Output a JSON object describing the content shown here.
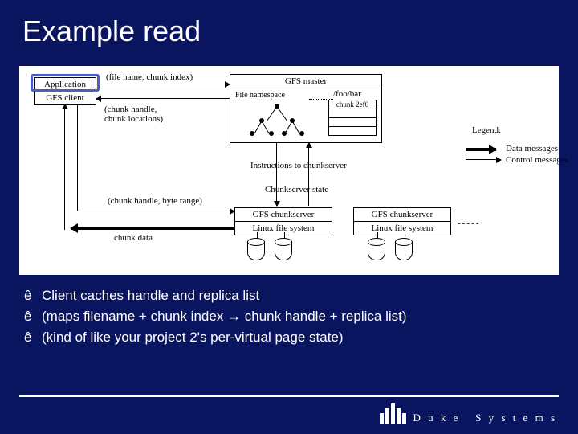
{
  "title": "Example read",
  "diagram": {
    "client": {
      "app": "Application",
      "lib": "GFS client"
    },
    "master": {
      "title": "GFS master",
      "ns_label": "File namespace",
      "path": "/foo/bar",
      "chunk": "chunk 2ef0"
    },
    "chunkserver": {
      "title": "GFS chunkserver",
      "fs": "Linux file system"
    },
    "labels": {
      "req": "(file name, chunk index)",
      "resp1": "(chunk handle,",
      "resp2": "chunk locations)",
      "range": "(chunk handle, byte range)",
      "data": "chunk data",
      "instr": "Instructions to chunkserver",
      "state": "Chunkserver state"
    },
    "legend": {
      "title": "Legend:",
      "data": "Data messages",
      "ctrl": "Control messages"
    }
  },
  "bullets": [
    "Client caches handle and replica list",
    "(maps filename + chunk index → chunk handle + replica list)",
    "(kind of like your project 2's per-virtual page state)"
  ],
  "bullet_char": "ê",
  "footer": {
    "brand1": "D u k e",
    "brand2": "S y s t e m s"
  }
}
